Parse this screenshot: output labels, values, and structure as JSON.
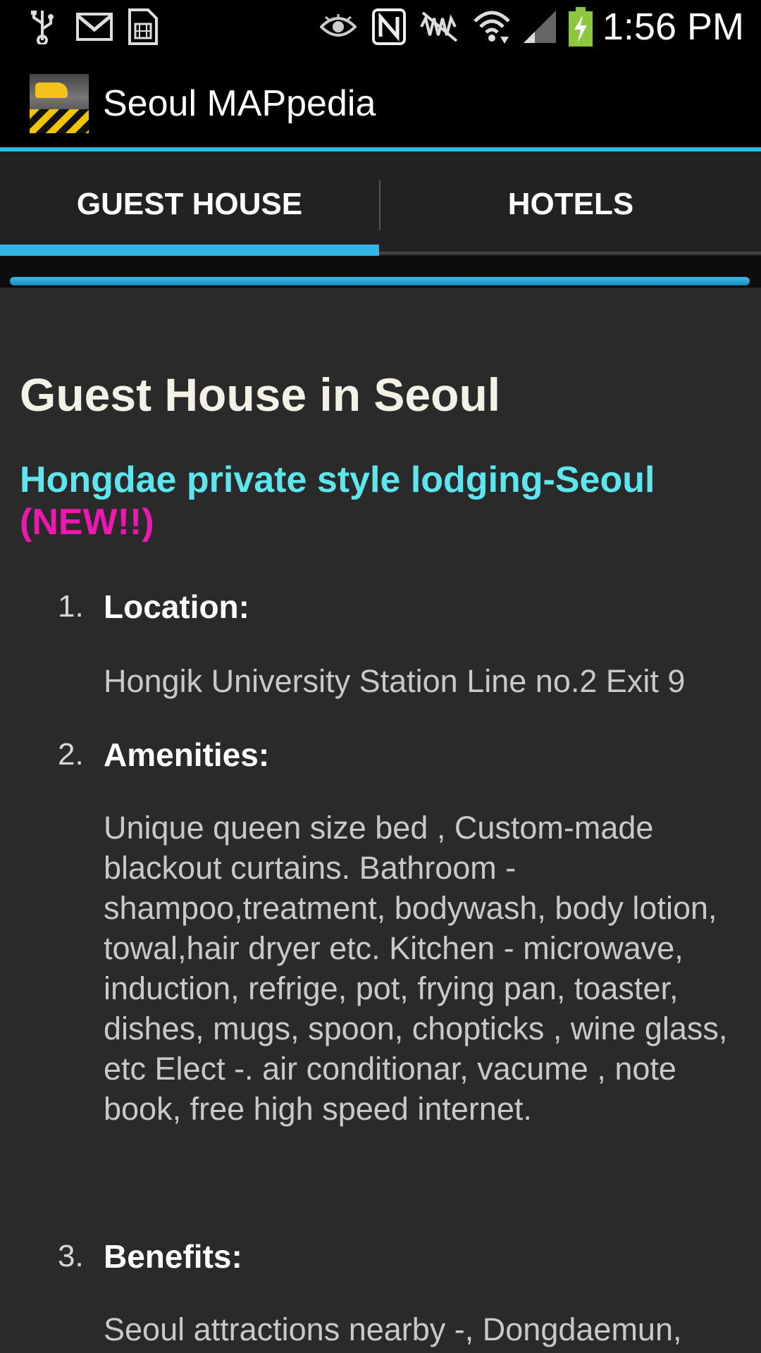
{
  "status_bar": {
    "time": "1:56 PM",
    "icons": [
      "usb-icon",
      "gmail-icon",
      "sim-icon",
      "eye-icon",
      "nfc-icon",
      "no-signal-icon",
      "wifi-icon",
      "signal-icon",
      "battery-charging-icon"
    ]
  },
  "action_bar": {
    "app_title": "Seoul MAPpedia",
    "accent_color": "#33b5e5"
  },
  "tabs": [
    {
      "label": "GUEST HOUSE",
      "selected": true
    },
    {
      "label": "HOTELS",
      "selected": false
    }
  ],
  "content": {
    "page_title": "Guest House in Seoul",
    "listing_title": "Hongdae private style lodging-Seoul",
    "listing_new": "(NEW!!)",
    "items": [
      {
        "number": "1.",
        "heading": "Location:",
        "body": "Hongik University Station Line no.2 Exit 9"
      },
      {
        "number": "2.",
        "heading": "Amenities:",
        "body": "Unique queen size bed , Custom-made blackout curtains. Bathroom - shampoo,treatment, bodywash, body lotion, towal,hair dryer etc. Kitchen - microwave, induction, refrige, pot, frying pan, toaster, dishes, mugs, spoon, chopticks , wine glass, etc Elect -. air conditionar, vacume , note book, free high speed internet."
      },
      {
        "number": "3.",
        "heading": "Benefits:",
        "body": "Seoul attractions nearby -, Dongdaemun, Namdaemun, Seoul station, Insa-dong,"
      }
    ]
  },
  "colors": {
    "title": "#f4f1e6",
    "listing_title": "#5ee6ef",
    "new_badge": "#ee17b1",
    "body_text": "#c9c9c9",
    "background": "#2a2a2a"
  }
}
